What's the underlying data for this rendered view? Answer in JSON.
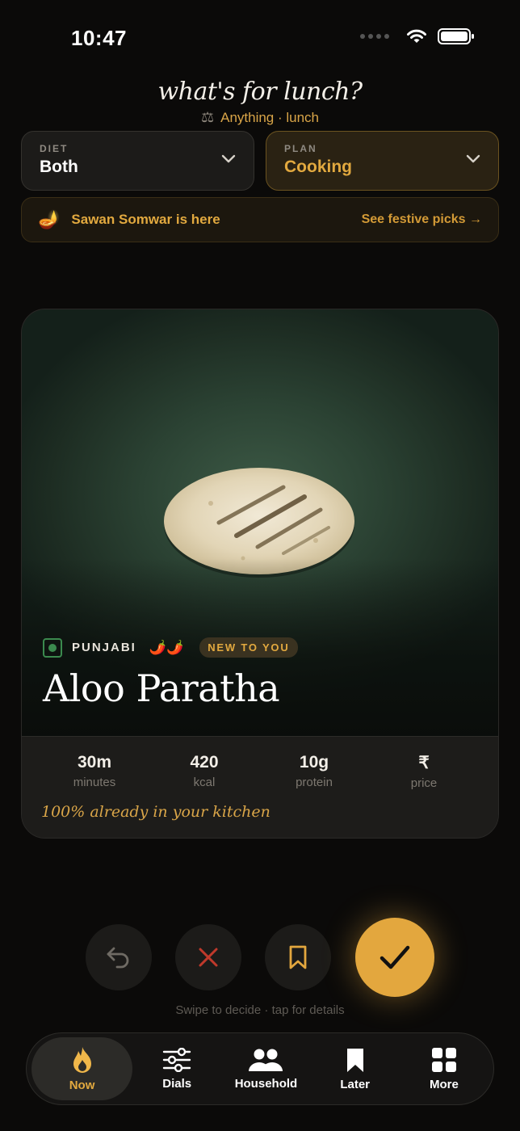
{
  "status": {
    "time": "10:47"
  },
  "header": {
    "title": "what's for lunch?",
    "subtitle": "Anything · lunch"
  },
  "diet": {
    "label": "DIET",
    "value": "Both"
  },
  "plan": {
    "label": "PLAN",
    "value": "Cooking"
  },
  "festive": {
    "text": "Sawan Somwar is here",
    "link": "See festive picks →"
  },
  "dish": {
    "cuisine": "PUNJABI",
    "spice": "🌶️🌶️",
    "badge": "NEW TO YOU",
    "name": "Aloo Paratha",
    "stats": [
      {
        "value": "30m",
        "label": "minutes"
      },
      {
        "value": "420",
        "label": "kcal"
      },
      {
        "value": "10g",
        "label": "protein"
      },
      {
        "value": "₹",
        "label": "price"
      }
    ],
    "kitchen_note": "100% already in your kitchen"
  },
  "hint": "Swipe to decide · tap for details",
  "tabs": [
    {
      "label": "Now",
      "icon": "flame-icon"
    },
    {
      "label": "Dials",
      "icon": "sliders-icon"
    },
    {
      "label": "Household",
      "icon": "people-icon"
    },
    {
      "label": "Later",
      "icon": "bookmark-icon"
    },
    {
      "label": "More",
      "icon": "grid-icon"
    }
  ],
  "colors": {
    "accent": "#e3a73e",
    "background": "#0b0a09",
    "card": "#1d1c1a",
    "veg": "#3b8a4e",
    "skip": "#c0392b"
  }
}
